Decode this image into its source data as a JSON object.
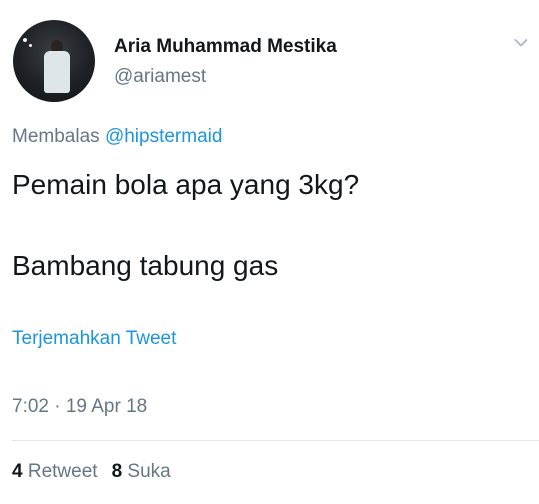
{
  "user": {
    "display_name": "Aria Muhammad Mestika",
    "handle": "@ariamest"
  },
  "reply": {
    "prefix": "Membalas",
    "mention": "@hipstermaid"
  },
  "tweet": {
    "lines": [
      "Pemain bola apa yang 3kg?",
      "Bambang tabung gas"
    ],
    "translate_label": "Terjemahkan Tweet",
    "timestamp": "7:02 · 19 Apr 18"
  },
  "stats": {
    "retweet_count": "4",
    "retweet_label": "Retweet",
    "like_count": "8",
    "like_label": "Suka"
  },
  "colors": {
    "link": "#1b95e0",
    "secondary_text": "#657786",
    "primary_text": "#14171a",
    "divider": "#e1e8ed"
  },
  "icons": {
    "menu": "chevron-down-icon"
  }
}
